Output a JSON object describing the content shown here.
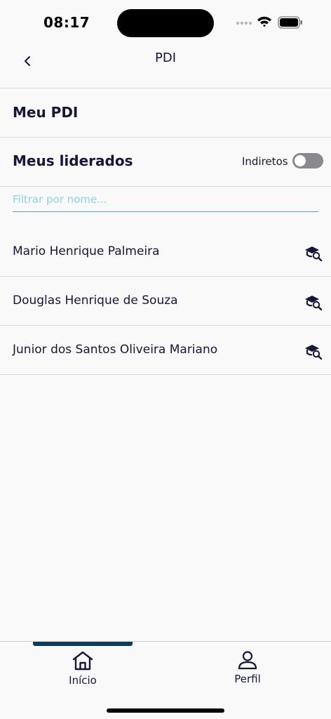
{
  "status_bar": {
    "time": "08:17"
  },
  "header": {
    "title": "PDI",
    "back_icon": "chevron-left-icon"
  },
  "my_pdi": {
    "label": "Meu PDI"
  },
  "led": {
    "title": "Meus liderados",
    "toggle_label": "Indiretos",
    "toggle_on": false
  },
  "filter": {
    "placeholder": "Filtrar por nome...",
    "value": ""
  },
  "people": [
    {
      "name": "Mario Henrique Palmeira",
      "icon": "graduation-search-icon"
    },
    {
      "name": "Douglas Henrique de Souza",
      "icon": "graduation-search-icon"
    },
    {
      "name": "Junior dos Santos Oliveira Mariano",
      "icon": "graduation-search-icon"
    }
  ],
  "tabs": [
    {
      "label": "Início",
      "icon": "home-icon",
      "active": true
    },
    {
      "label": "Perfil",
      "icon": "user-icon",
      "active": false
    }
  ],
  "colors": {
    "text": "#15163a",
    "accent": "#0f3b5f",
    "filter_line": "#4aa9c9",
    "toggle_off": "#8a8a8e"
  }
}
